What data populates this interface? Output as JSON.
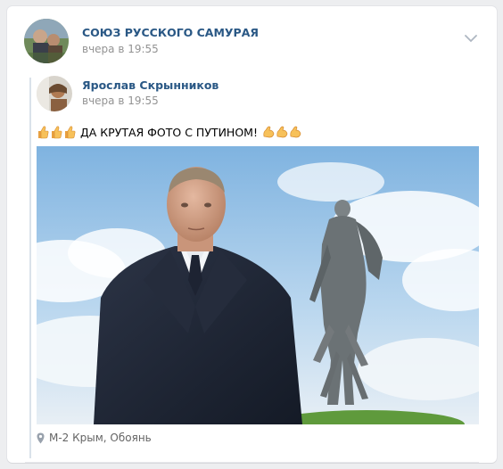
{
  "group": {
    "name": "СОЮЗ РУССКОГО САМУРАЯ",
    "time": "вчера в 19:55"
  },
  "repost": {
    "author": "Ярослав Скрынников",
    "time": "вчера в 19:55",
    "text": "ДА КРУТАЯ ФОТО С ПУТИНОМ!",
    "emoji_before": "thumbs-up x3",
    "emoji_after": "flexed-biceps x3",
    "location": "М-2 Крым, Обоянь"
  },
  "icons": {
    "menu": "chevron-down-icon",
    "location": "map-pin-icon"
  },
  "colors": {
    "link": "#2a5885",
    "muted": "#939393",
    "repost_bar": "#dae2ea",
    "background": "#edeef0"
  }
}
